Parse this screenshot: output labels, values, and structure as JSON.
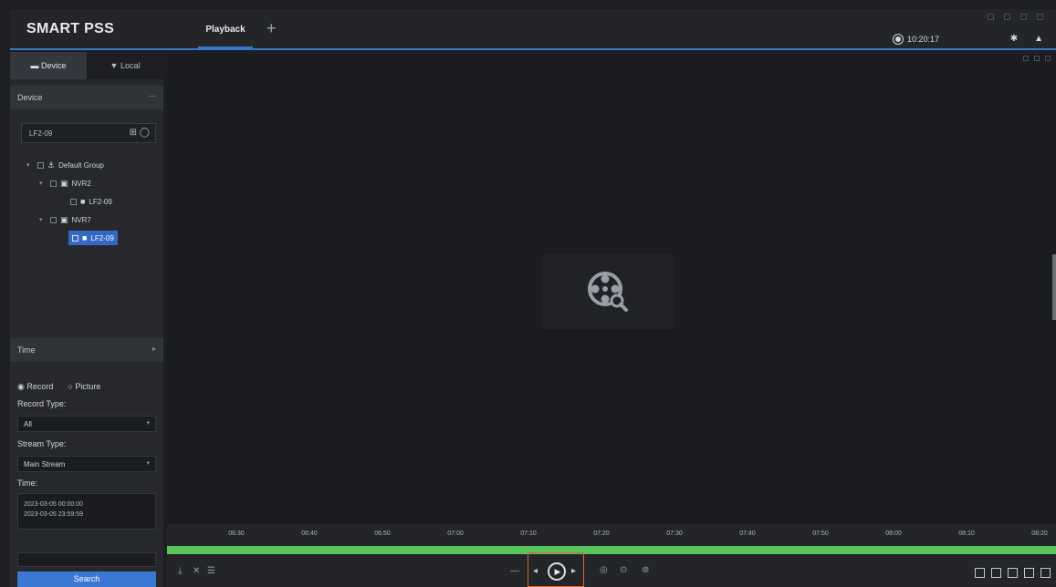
{
  "app": {
    "title": "SMART PSS"
  },
  "tabs": [
    {
      "label": "Playback"
    }
  ],
  "header": {
    "time": "10:20:17"
  },
  "sidebar": {
    "tabs": {
      "device": "Device",
      "local": "Local"
    },
    "device_section": "Device",
    "search_value": "LF2-09",
    "tree": {
      "group": "Default Group",
      "nvr1": "NVR2",
      "cam1": "LF2-09",
      "nvr2": "NVR7",
      "cam2": "LF2-09"
    },
    "time_section": "Time",
    "radio_record": "Record",
    "radio_picture": "Picture",
    "record_type_label": "Record Type:",
    "record_type_value": "All",
    "stream_type_label": "Stream Type:",
    "stream_type_value": "Main Stream",
    "time_label": "Time:",
    "time_line1": "2023-03-05 00:00:00",
    "time_line2": "2023-03-05 23:59:59",
    "search_button": "Search"
  },
  "timeline": {
    "ticks": [
      "06:30",
      "06:40",
      "06:50",
      "07:00",
      "07:10",
      "07:20",
      "07:30",
      "07:40",
      "07:50",
      "08:00",
      "08:10",
      "08:20"
    ]
  },
  "icons": {
    "placeholder": "film-reel-icon",
    "gear": "gear-icon",
    "play": "play-icon"
  },
  "colors": {
    "accent": "#3a78c9",
    "timeline_bar": "#59c35c",
    "highlight": "#e0642a"
  }
}
